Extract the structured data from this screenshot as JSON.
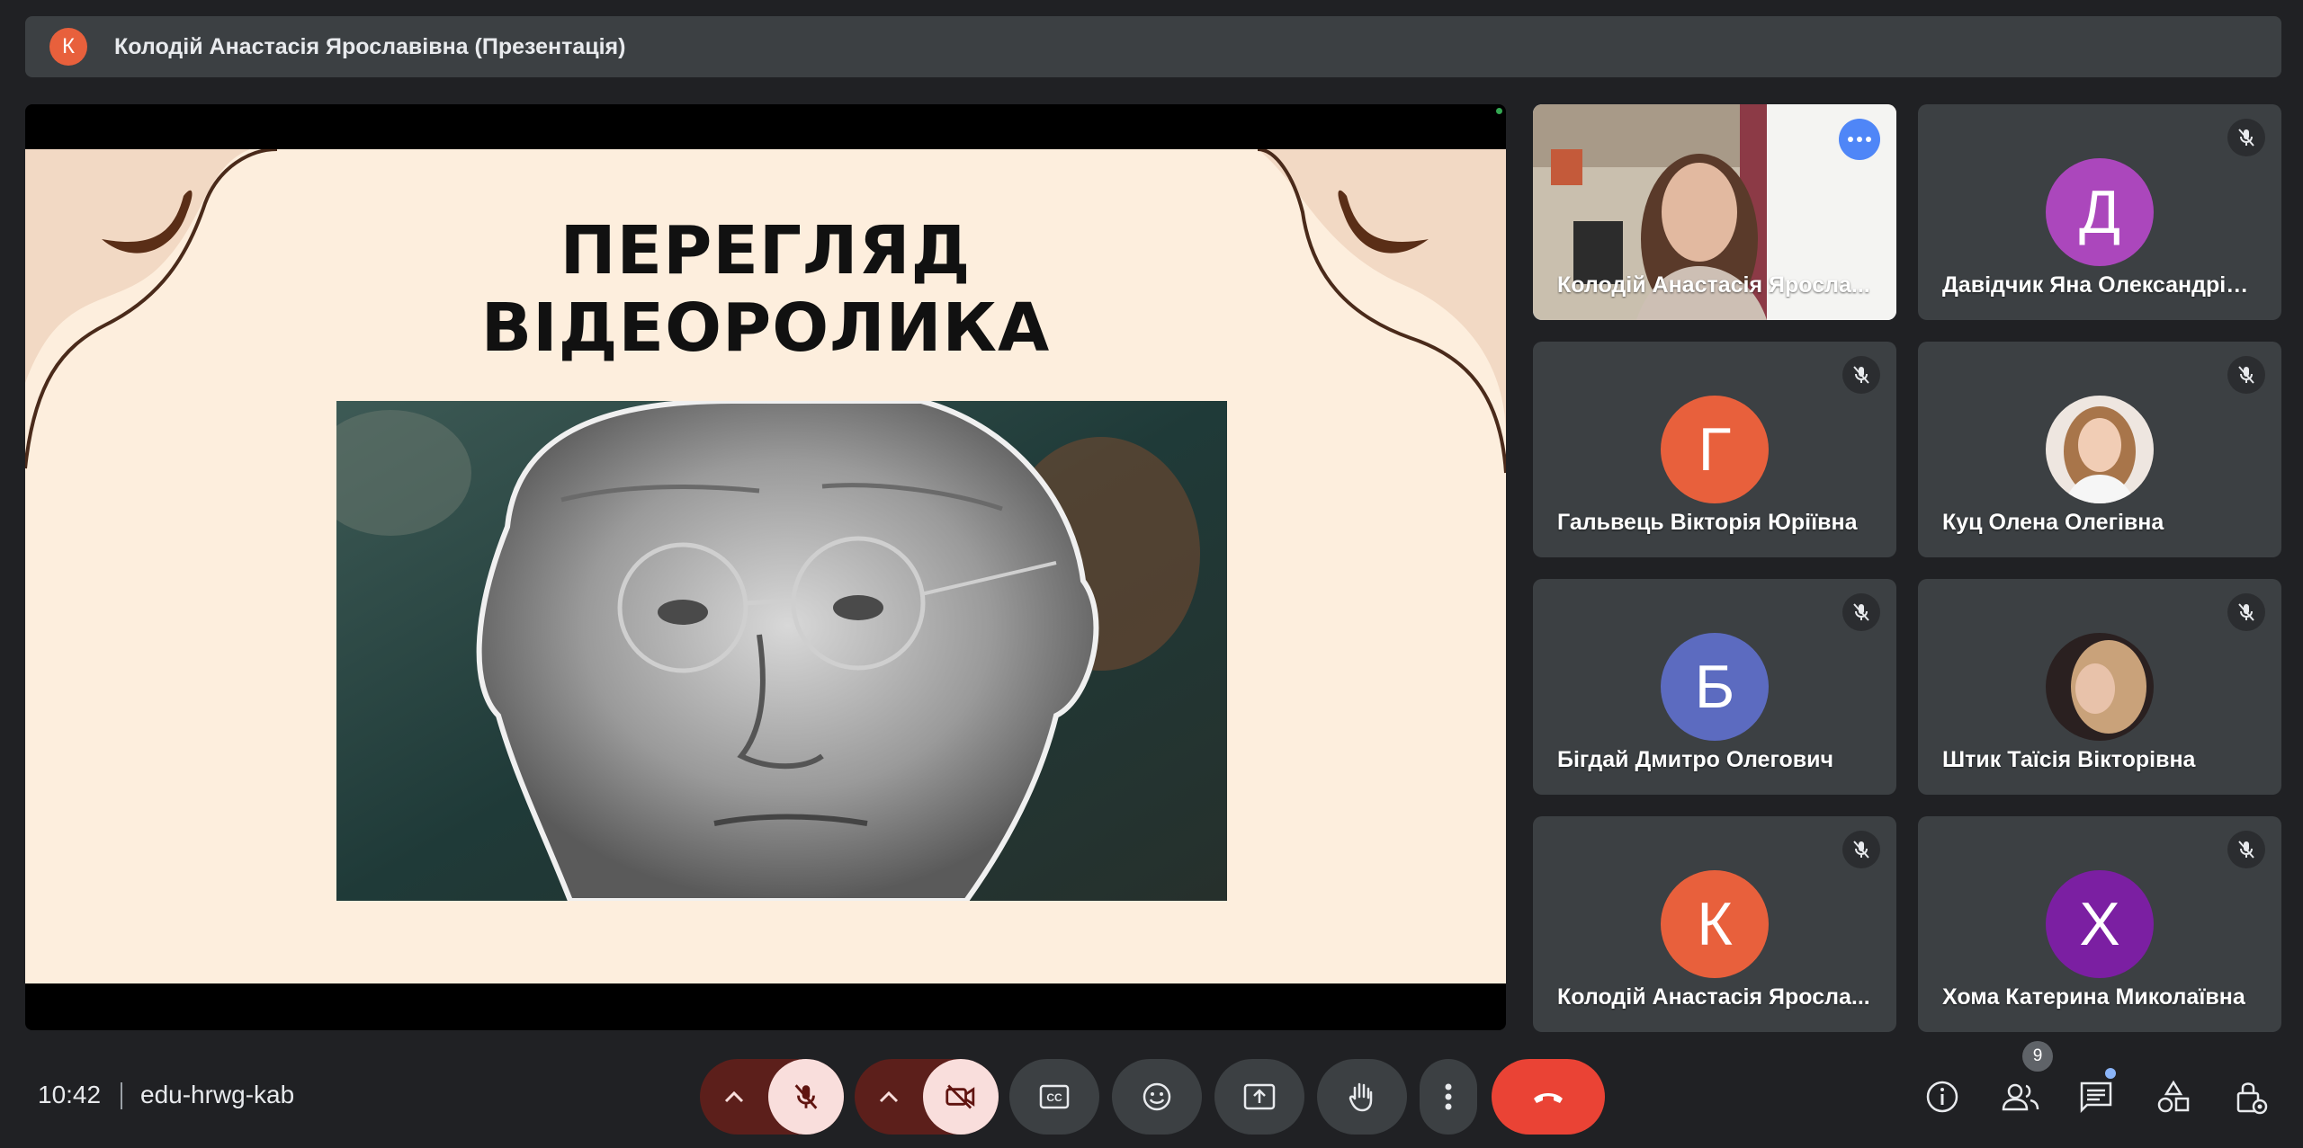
{
  "meeting": {
    "presenter_initial": "К",
    "presentation_title": "Колодій Анастасія Ярославівна (Презентація)",
    "time": "10:42",
    "code": "edu-hrwg-kab"
  },
  "slide": {
    "title_line1": "ПЕРЕГЛЯД",
    "title_line2": "ВІДЕОРОЛИКА"
  },
  "participants": [
    {
      "name": "Колодій Анастасія Яросла...",
      "video": true,
      "active": true
    },
    {
      "name": "Давідчик Яна Олександрів...",
      "initial": "Д",
      "color": "#ab47bc",
      "muted": true
    },
    {
      "name": "Гальвець Вікторія Юріївна",
      "initial": "Г",
      "color": "#e8603c",
      "muted": true
    },
    {
      "name": "Куц Олена Олегівна",
      "photo": true,
      "muted": true
    },
    {
      "name": "Бігдай Дмитро Олегович",
      "initial": "Б",
      "color": "#5c6bc0",
      "muted": true
    },
    {
      "name": "Штик Таїсія Вікторівна",
      "photo": true,
      "muted": true
    },
    {
      "name": "Колодій Анастасія Яросла...",
      "initial": "К",
      "color": "#e8603c",
      "muted": true
    },
    {
      "name": "Хома Катерина Миколаївна",
      "initial": "Х",
      "color": "#7b1fa2",
      "muted": true
    }
  ],
  "controls": {
    "participants_count": "9",
    "icons": [
      "chevron-up-icon",
      "mic-off-icon",
      "camera-off-icon",
      "captions-icon",
      "emoji-icon",
      "present-icon",
      "raise-hand-icon",
      "more-options-icon",
      "hang-up-icon",
      "info-icon",
      "people-icon",
      "chat-icon",
      "activities-icon",
      "host-controls-icon"
    ]
  },
  "colors": {
    "background": "#202124",
    "surface": "#3c4043",
    "danger": "#ea4335",
    "accent": "#8ab4f8"
  }
}
